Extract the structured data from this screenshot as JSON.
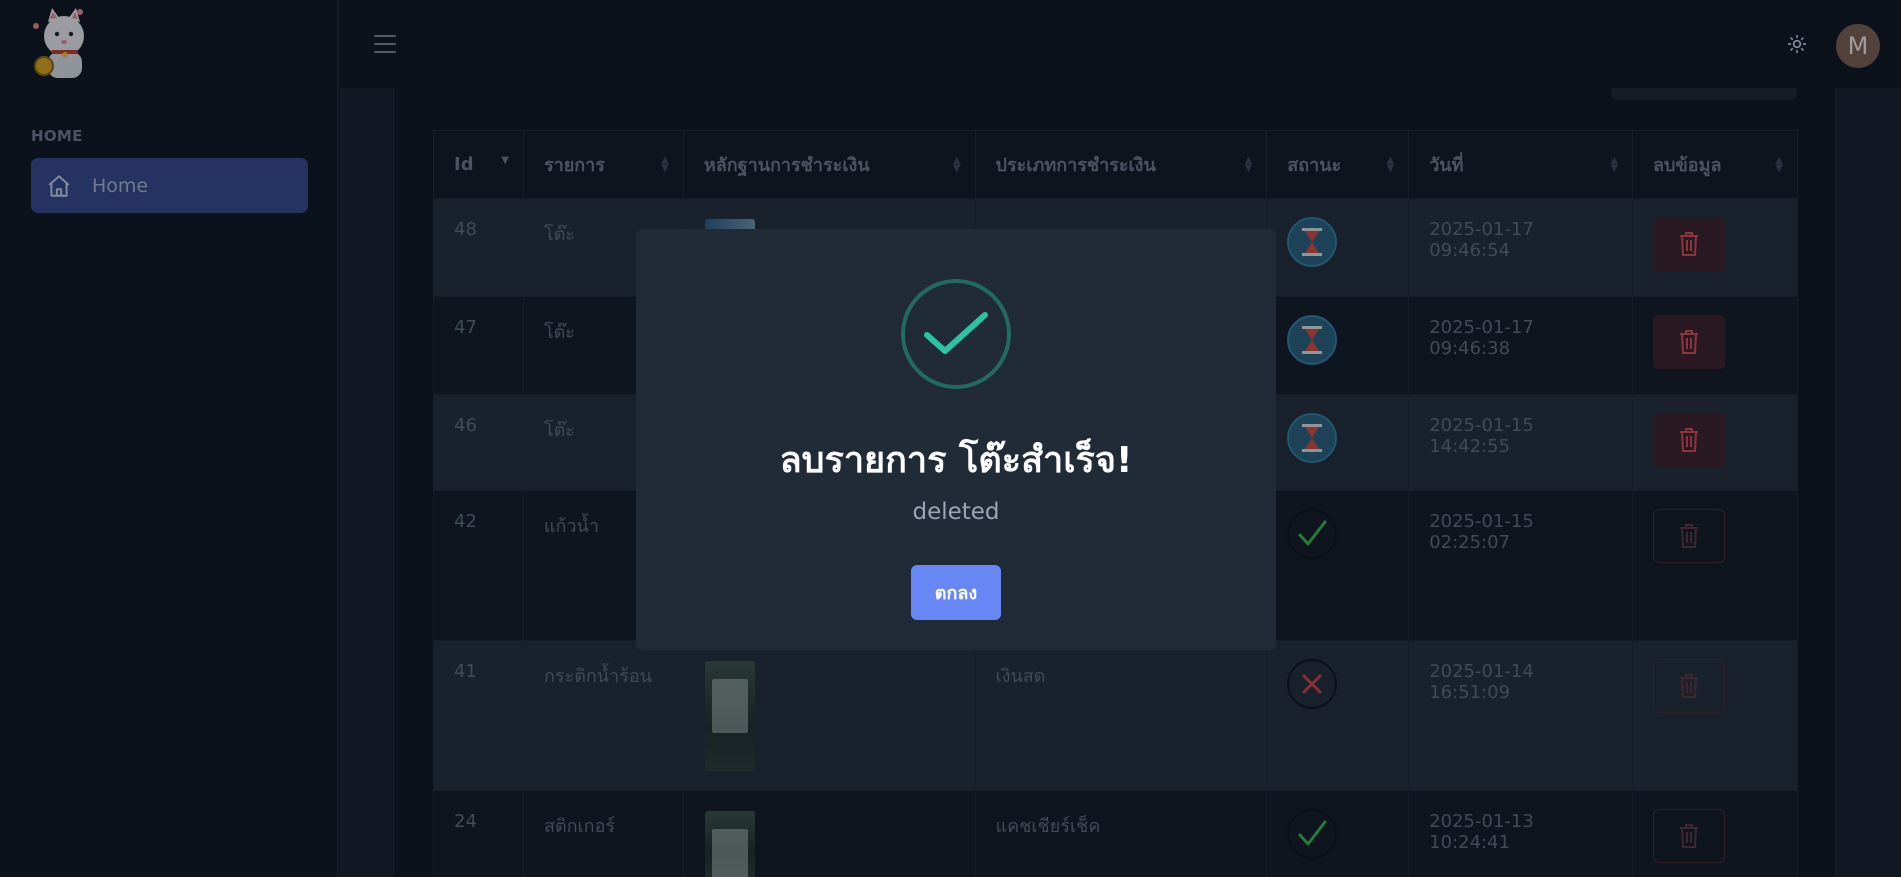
{
  "sidebar": {
    "section_label": "HOME",
    "items": [
      {
        "label": "Home",
        "icon": "home-icon"
      }
    ]
  },
  "header": {
    "avatar_initial": "M",
    "theme_icon": "sun-icon",
    "menu_icon": "hamburger-icon"
  },
  "table": {
    "columns": [
      "Id",
      "รายการ",
      "หลักฐานการชำระเงิน",
      "ประเภทการชำระเงิน",
      "สถานะ",
      "วันที่",
      "ลบข้อมูล"
    ],
    "rows": [
      {
        "id": "48",
        "item": "โต๊ะ",
        "payment_type": "",
        "status": "pending",
        "date": "2025-01-17 09:46:54"
      },
      {
        "id": "47",
        "item": "โต๊ะ",
        "payment_type": "",
        "status": "pending",
        "date": "2025-01-17 09:46:38"
      },
      {
        "id": "46",
        "item": "โต๊ะ",
        "payment_type": "",
        "status": "pending",
        "date": "2025-01-15 14:42:55"
      },
      {
        "id": "42",
        "item": "แก้วน้ำ",
        "payment_type": "",
        "status": "approved",
        "date": "2025-01-15 02:25:07"
      },
      {
        "id": "41",
        "item": "กระติกน้ำร้อน",
        "payment_type": "เงินสด",
        "status": "rejected",
        "date": "2025-01-14 16:51:09"
      },
      {
        "id": "24",
        "item": "สติกเกอร์",
        "payment_type": "แคชเชียร์เช็ค",
        "status": "approved",
        "date": "2025-01-13 10:24:41"
      }
    ]
  },
  "modal": {
    "title": "ลบรายการ โต๊ะสำเร็จ!",
    "text": "deleted",
    "confirm_label": "ตกลง",
    "icon": "success-check-icon"
  },
  "colors": {
    "accent": "#6787f5",
    "nav_active": "#34478a",
    "success": "#236b60",
    "danger_bg": "#3a1f28"
  }
}
